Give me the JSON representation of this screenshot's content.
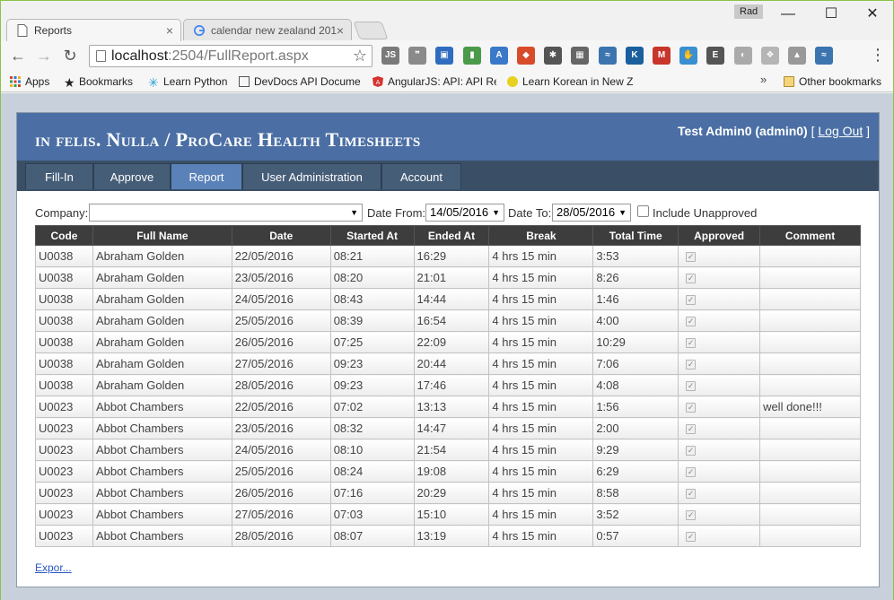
{
  "browser": {
    "tabs": [
      {
        "title": "Reports",
        "active": true
      },
      {
        "title": "calendar new zealand 201",
        "active": false
      }
    ],
    "profile_label": "Rad",
    "url_host": "localhost",
    "url_rest": ":2504/FullReport.aspx",
    "extensions": [
      {
        "name": "js-icon",
        "glyph": "JS",
        "color": "#7a7a7a"
      },
      {
        "name": "speech-icon",
        "glyph": "❞",
        "color": "#8a8a8a"
      },
      {
        "name": "box-icon",
        "glyph": "▣",
        "color": "#2f6cc0"
      },
      {
        "name": "paint-icon",
        "glyph": "▮",
        "color": "#4a9a4a"
      },
      {
        "name": "a-icon",
        "glyph": "A",
        "color": "#3a78c9"
      },
      {
        "name": "colorbox-icon",
        "glyph": "◆",
        "color": "#d84b2b"
      },
      {
        "name": "bug-icon",
        "glyph": "✱",
        "color": "#555"
      },
      {
        "name": "grid-icon",
        "glyph": "▦",
        "color": "#666"
      },
      {
        "name": "python-icon",
        "glyph": "≈",
        "color": "#3c74b0"
      },
      {
        "name": "k-icon",
        "glyph": "K",
        "color": "#1a5f9e"
      },
      {
        "name": "gmail-icon",
        "glyph": "M",
        "color": "#c8352b"
      },
      {
        "name": "hand-icon",
        "glyph": "✋",
        "color": "#3a8fd0"
      },
      {
        "name": "evernote-icon",
        "glyph": "E",
        "color": "#555"
      },
      {
        "name": "circle-icon",
        "glyph": "◐",
        "color": "#aaa"
      },
      {
        "name": "dropbox-icon",
        "glyph": "❖",
        "color": "#b5b5b5"
      },
      {
        "name": "drive-icon",
        "glyph": "▲",
        "color": "#999"
      },
      {
        "name": "python2-icon",
        "glyph": "≈",
        "color": "#3c74b0"
      }
    ],
    "bookmarks": [
      {
        "label": "Apps",
        "icon": "apps-icon"
      },
      {
        "label": "Bookmarks",
        "icon": "star-icon"
      },
      {
        "label": "Learn Python",
        "icon": "snowflake-icon"
      },
      {
        "label": "DevDocs API Docume",
        "icon": "search-doc-icon"
      },
      {
        "label": "AngularJS: API: API Re",
        "icon": "angular-icon"
      },
      {
        "label": "Learn Korean in New Z",
        "icon": "bird-icon"
      }
    ],
    "other_bookmarks": "Other bookmarks"
  },
  "header": {
    "title": "in felis. Nulla / ProCare Health Timesheets",
    "user": "Test Admin0 (admin0)",
    "bracket_open": "[",
    "logout": "Log Out",
    "bracket_close": "]"
  },
  "menu": [
    "Fill-In",
    "Approve",
    "Report",
    "User Administration",
    "Account"
  ],
  "filters": {
    "company_label": "Company:",
    "company_value": "",
    "date_from_label": "Date From:",
    "date_from": "14/05/2016",
    "date_to_label": "Date To:",
    "date_to": "28/05/2016",
    "include_unapproved": "Include Unapproved"
  },
  "table": {
    "columns": [
      "Code",
      "Full Name",
      "Date",
      "Started At",
      "Ended At",
      "Break",
      "Total Time",
      "Approved",
      "Comment"
    ],
    "rows": [
      [
        "U0038",
        "Abraham Golden",
        "22/05/2016",
        "08:21",
        "16:29",
        "4 hrs 15 min",
        "3:53",
        "✓",
        ""
      ],
      [
        "U0038",
        "Abraham Golden",
        "23/05/2016",
        "08:20",
        "21:01",
        "4 hrs 15 min",
        "8:26",
        "✓",
        ""
      ],
      [
        "U0038",
        "Abraham Golden",
        "24/05/2016",
        "08:43",
        "14:44",
        "4 hrs 15 min",
        "1:46",
        "✓",
        ""
      ],
      [
        "U0038",
        "Abraham Golden",
        "25/05/2016",
        "08:39",
        "16:54",
        "4 hrs 15 min",
        "4:00",
        "✓",
        ""
      ],
      [
        "U0038",
        "Abraham Golden",
        "26/05/2016",
        "07:25",
        "22:09",
        "4 hrs 15 min",
        "10:29",
        "✓",
        ""
      ],
      [
        "U0038",
        "Abraham Golden",
        "27/05/2016",
        "09:23",
        "20:44",
        "4 hrs 15 min",
        "7:06",
        "✓",
        ""
      ],
      [
        "U0038",
        "Abraham Golden",
        "28/05/2016",
        "09:23",
        "17:46",
        "4 hrs 15 min",
        "4:08",
        "✓",
        ""
      ],
      [
        "U0023",
        "Abbot Chambers",
        "22/05/2016",
        "07:02",
        "13:13",
        "4 hrs 15 min",
        "1:56",
        "✓",
        "well done!!!"
      ],
      [
        "U0023",
        "Abbot Chambers",
        "23/05/2016",
        "08:32",
        "14:47",
        "4 hrs 15 min",
        "2:00",
        "✓",
        ""
      ],
      [
        "U0023",
        "Abbot Chambers",
        "24/05/2016",
        "08:10",
        "21:54",
        "4 hrs 15 min",
        "9:29",
        "✓",
        ""
      ],
      [
        "U0023",
        "Abbot Chambers",
        "25/05/2016",
        "08:24",
        "19:08",
        "4 hrs 15 min",
        "6:29",
        "✓",
        ""
      ],
      [
        "U0023",
        "Abbot Chambers",
        "26/05/2016",
        "07:16",
        "20:29",
        "4 hrs 15 min",
        "8:58",
        "✓",
        ""
      ],
      [
        "U0023",
        "Abbot Chambers",
        "27/05/2016",
        "07:03",
        "15:10",
        "4 hrs 15 min",
        "3:52",
        "✓",
        ""
      ],
      [
        "U0023",
        "Abbot Chambers",
        "28/05/2016",
        "08:07",
        "13:19",
        "4 hrs 15 min",
        "0:57",
        "✓",
        ""
      ]
    ]
  },
  "export_label": "Expor..."
}
